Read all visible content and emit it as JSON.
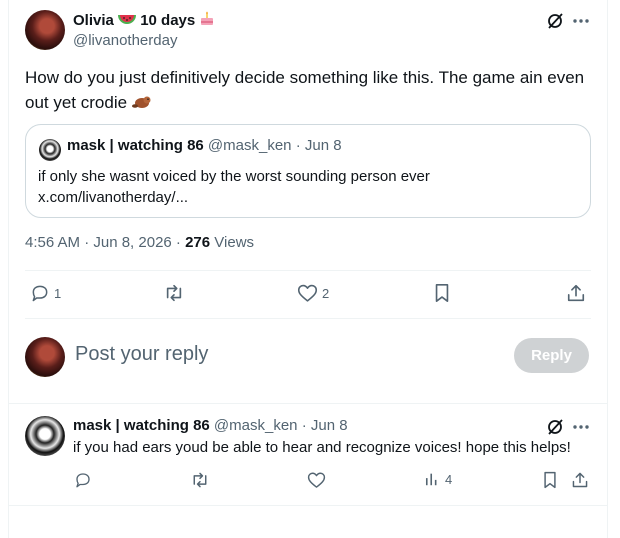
{
  "post": {
    "author_name": "Olivia",
    "author_tag": "10 days",
    "handle": "@livanotherday",
    "text": "How do you just definitively decide something like this.  The game ain even out yet crodie",
    "timestamp": "4:56 AM · Jun 8, 2026 · ",
    "views_count": "276",
    "views_label": " Views",
    "stats": {
      "replies": "1",
      "reposts": "",
      "likes": "2"
    }
  },
  "quote": {
    "author_name": "mask | watching 86",
    "handle_date": " @mask_ken · Jun 8",
    "text": "if only she wasnt voiced by the worst sounding person ever",
    "link": "x.com/livanotherday/..."
  },
  "composer": {
    "placeholder": "Post your reply",
    "reply_button": "Reply"
  },
  "reply": {
    "author_name": "mask | watching 86",
    "handle_date": " @mask_ken · Jun 8",
    "text": "if you had ears youd be able to hear and recognize voices! hope this helps!",
    "views": "4"
  },
  "icons": {
    "grok": "grok-slash-icon",
    "more": "more-dots-icon",
    "reply": "reply-bubble-icon",
    "repost": "repost-icon",
    "like": "heart-icon",
    "bookmark": "bookmark-icon",
    "share": "share-icon",
    "views": "views-chart-icon"
  },
  "colors": {
    "text": "#0f1419",
    "muted": "#536471",
    "border": "#cfd9de",
    "reply_btn": "#cfd2d4"
  }
}
